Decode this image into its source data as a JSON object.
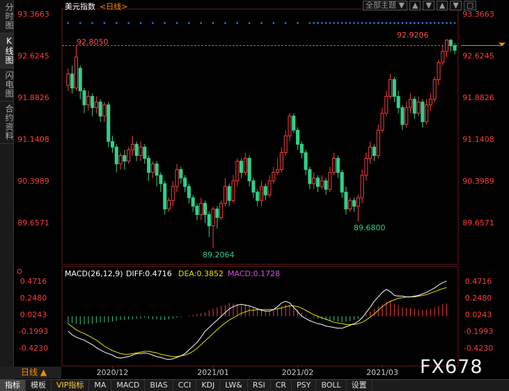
{
  "left_tabs": [
    {
      "label": "分时图",
      "active": false
    },
    {
      "label": "K线图",
      "active": true
    },
    {
      "label": "闪电图",
      "active": false
    },
    {
      "label": "合约资料",
      "active": false
    }
  ],
  "title": {
    "name": "美元指数",
    "period": "<日线>"
  },
  "top_controls": {
    "theme_select": "全部主题",
    "arrow": "▼",
    "buttons": [
      "▲",
      "▼",
      "▲",
      "▼",
      "▢"
    ]
  },
  "colors": {
    "up": "#ff3b3b",
    "down": "#30d08a",
    "dea": "#e8e000",
    "macd": "#d050e0",
    "diff": "#ffffff",
    "grid": "#3a1010",
    "axis_text": "#ff3b3b",
    "dots": "#2f80ed"
  },
  "price_axis": {
    "ticks": [
      "93.3663",
      "92.6245",
      "91.8826",
      "91.1408",
      "90.3989",
      "89.6571"
    ],
    "tick_values": [
      93.3663,
      92.6245,
      91.8826,
      91.1408,
      90.3989,
      89.6571
    ]
  },
  "macd_axis": {
    "ticks": [
      "0.4716",
      "0.2480",
      "0.0243",
      "-0.1993",
      "-0.4230"
    ],
    "tick_values": [
      0.4716,
      0.248,
      0.0243,
      -0.1993,
      -0.423
    ]
  },
  "macd_legend": {
    "name": "MACD(26,12,9)",
    "diff": "DIFF:0.4716",
    "dea": "DEA:0.3852",
    "macd": "MACD:0.1728"
  },
  "annotations": {
    "high_left": "92.8050",
    "high_right": "92.9206",
    "low_main": "89.2064",
    "low_second": "89.6800"
  },
  "x_axis": {
    "labels": [
      "2020/12",
      "2021/01",
      "2021/02",
      "2021/03"
    ],
    "label_index": [
      11,
      36,
      57,
      78
    ]
  },
  "period_label": "日线 ▲",
  "toolbar": [
    {
      "label": "指标",
      "active": true,
      "vip": false
    },
    {
      "label": "模板",
      "active": false,
      "vip": false
    },
    {
      "label": "VIP指标",
      "active": false,
      "vip": true
    },
    {
      "label": "MA",
      "active": false,
      "vip": false
    },
    {
      "label": "MACD",
      "active": false,
      "vip": false
    },
    {
      "label": "BIAS",
      "active": false,
      "vip": false
    },
    {
      "label": "CCI",
      "active": false,
      "vip": false
    },
    {
      "label": "KDJ",
      "active": false,
      "vip": false
    },
    {
      "label": "LW&",
      "active": false,
      "vip": false
    },
    {
      "label": "RSI",
      "active": false,
      "vip": false
    },
    {
      "label": "CR",
      "active": false,
      "vip": false
    },
    {
      "label": "PSY",
      "active": false,
      "vip": false
    },
    {
      "label": "BOLL",
      "active": false,
      "vip": false
    },
    {
      "label": "设置",
      "active": false,
      "vip": false
    }
  ],
  "watermark": "FX678",
  "chart_data": {
    "type": "candlestick",
    "title": "美元指数 <日线>",
    "ylim": [
      89.2,
      93.45
    ],
    "candles": [
      [
        92.1,
        92.3,
        92.0,
        92.4
      ],
      [
        92.3,
        92.05,
        91.95,
        92.45
      ],
      [
        92.05,
        92.6,
        92.0,
        92.81
      ],
      [
        92.4,
        92.0,
        91.85,
        92.45
      ],
      [
        92.0,
        91.75,
        91.6,
        92.05
      ],
      [
        91.75,
        91.9,
        91.65,
        92.0
      ],
      [
        91.9,
        91.7,
        91.55,
        91.95
      ],
      [
        91.7,
        91.8,
        91.6,
        91.9
      ],
      [
        91.8,
        91.55,
        91.45,
        91.85
      ],
      [
        91.55,
        91.75,
        91.45,
        91.8
      ],
      [
        91.75,
        91.1,
        91.0,
        91.8
      ],
      [
        91.1,
        91.0,
        90.9,
        91.2
      ],
      [
        91.0,
        90.7,
        90.55,
        91.05
      ],
      [
        90.7,
        90.85,
        90.6,
        90.9
      ],
      [
        90.85,
        90.75,
        90.6,
        90.95
      ],
      [
        90.75,
        90.95,
        90.7,
        91.0
      ],
      [
        90.95,
        91.05,
        90.85,
        91.2
      ],
      [
        91.05,
        90.85,
        90.75,
        91.1
      ],
      [
        90.85,
        91.0,
        90.75,
        91.1
      ],
      [
        91.0,
        90.8,
        90.7,
        91.05
      ],
      [
        90.8,
        90.55,
        90.4,
        90.85
      ],
      [
        90.55,
        90.7,
        90.45,
        90.75
      ],
      [
        90.7,
        90.5,
        90.3,
        90.75
      ],
      [
        90.5,
        90.35,
        90.2,
        90.55
      ],
      [
        90.35,
        89.9,
        89.8,
        90.4
      ],
      [
        89.9,
        90.05,
        89.85,
        90.1
      ],
      [
        90.05,
        90.3,
        89.95,
        90.4
      ],
      [
        90.3,
        90.6,
        90.2,
        90.7
      ],
      [
        90.6,
        90.45,
        90.35,
        90.65
      ],
      [
        90.45,
        90.3,
        90.2,
        90.5
      ],
      [
        90.3,
        90.1,
        90.0,
        90.35
      ],
      [
        90.1,
        89.95,
        89.85,
        90.15
      ],
      [
        89.95,
        89.8,
        89.7,
        90.0
      ],
      [
        89.8,
        90.0,
        89.7,
        90.1
      ],
      [
        90.0,
        89.8,
        89.65,
        90.05
      ],
      [
        89.8,
        89.6,
        89.4,
        89.85
      ],
      [
        89.6,
        89.9,
        89.21,
        89.95
      ],
      [
        89.9,
        89.75,
        89.55,
        89.95
      ],
      [
        89.75,
        90.0,
        89.7,
        90.05
      ],
      [
        90.0,
        90.3,
        89.95,
        90.45
      ],
      [
        90.3,
        90.05,
        89.95,
        90.35
      ],
      [
        90.05,
        90.4,
        90.0,
        90.5
      ],
      [
        90.4,
        90.75,
        90.3,
        90.8
      ],
      [
        90.75,
        90.55,
        90.45,
        90.8
      ],
      [
        90.55,
        90.8,
        90.5,
        90.9
      ],
      [
        90.8,
        90.4,
        90.3,
        90.85
      ],
      [
        90.4,
        90.2,
        90.1,
        90.45
      ],
      [
        90.2,
        90.05,
        89.95,
        90.25
      ],
      [
        90.05,
        90.3,
        89.95,
        90.4
      ],
      [
        90.3,
        90.15,
        90.05,
        90.35
      ],
      [
        90.15,
        90.4,
        90.1,
        90.5
      ],
      [
        90.4,
        90.55,
        90.35,
        90.65
      ],
      [
        90.55,
        90.6,
        90.5,
        90.8
      ],
      [
        90.6,
        90.9,
        90.55,
        91.0
      ],
      [
        90.9,
        91.2,
        90.85,
        91.3
      ],
      [
        91.2,
        91.55,
        91.1,
        91.6
      ],
      [
        91.55,
        91.3,
        91.25,
        91.6
      ],
      [
        91.3,
        91.05,
        90.95,
        91.35
      ],
      [
        91.05,
        90.9,
        90.8,
        91.1
      ],
      [
        90.9,
        90.6,
        90.5,
        90.95
      ],
      [
        90.6,
        90.35,
        90.25,
        90.65
      ],
      [
        90.35,
        90.45,
        90.25,
        90.55
      ],
      [
        90.45,
        90.3,
        90.2,
        90.5
      ],
      [
        90.3,
        90.4,
        90.25,
        90.5
      ],
      [
        90.4,
        90.25,
        90.15,
        90.45
      ],
      [
        90.25,
        90.55,
        90.2,
        90.65
      ],
      [
        90.55,
        90.8,
        90.5,
        90.9
      ],
      [
        90.8,
        90.55,
        90.45,
        90.85
      ],
      [
        90.55,
        90.2,
        90.1,
        90.6
      ],
      [
        90.2,
        89.9,
        89.8,
        90.3
      ],
      [
        89.9,
        90.05,
        89.85,
        90.1
      ],
      [
        90.05,
        89.95,
        89.85,
        90.1
      ],
      [
        89.95,
        90.1,
        89.68,
        90.15
      ],
      [
        90.1,
        90.5,
        90.0,
        90.6
      ],
      [
        90.5,
        90.8,
        90.4,
        90.9
      ],
      [
        90.8,
        91.0,
        90.7,
        91.1
      ],
      [
        91.0,
        90.85,
        90.75,
        91.05
      ],
      [
        90.85,
        91.3,
        90.8,
        91.4
      ],
      [
        91.3,
        91.6,
        91.25,
        91.7
      ],
      [
        91.6,
        91.9,
        91.55,
        92.0
      ],
      [
        91.9,
        92.2,
        91.85,
        92.3
      ],
      [
        92.2,
        91.9,
        91.8,
        92.25
      ],
      [
        91.9,
        91.7,
        91.6,
        92.0
      ],
      [
        91.7,
        91.4,
        91.3,
        91.75
      ],
      [
        91.4,
        91.7,
        91.35,
        91.8
      ],
      [
        91.7,
        91.85,
        91.6,
        91.95
      ],
      [
        91.85,
        91.6,
        91.5,
        91.9
      ],
      [
        91.6,
        91.8,
        91.55,
        91.9
      ],
      [
        91.8,
        91.45,
        91.35,
        91.85
      ],
      [
        91.45,
        91.75,
        91.4,
        91.85
      ],
      [
        91.75,
        91.85,
        91.65,
        91.95
      ],
      [
        91.85,
        92.2,
        91.8,
        92.25
      ],
      [
        92.2,
        92.5,
        92.1,
        92.55
      ],
      [
        92.5,
        92.7,
        92.45,
        92.8
      ],
      [
        92.7,
        92.9,
        92.6,
        92.92
      ],
      [
        92.9,
        92.8,
        92.7,
        92.92
      ],
      [
        92.8,
        92.72,
        92.65,
        92.85
      ]
    ],
    "macd": {
      "hist": [
        -0.1,
        -0.09,
        -0.1,
        -0.11,
        -0.11,
        -0.1,
        -0.1,
        -0.09,
        -0.08,
        -0.08,
        -0.08,
        -0.07,
        -0.06,
        -0.05,
        -0.05,
        -0.04,
        -0.04,
        -0.03,
        -0.03,
        -0.02,
        -0.03,
        -0.04,
        -0.04,
        -0.05,
        -0.05,
        -0.04,
        -0.03,
        -0.02,
        -0.01,
        0.0,
        0.01,
        0.02,
        0.03,
        0.04,
        0.05,
        0.08,
        0.1,
        0.12,
        0.14,
        0.15,
        0.18,
        0.17,
        0.16,
        0.15,
        0.15,
        0.13,
        0.12,
        0.1,
        0.09,
        0.08,
        0.07,
        0.08,
        0.1,
        0.14,
        0.16,
        0.15,
        0.12,
        0.09,
        0.05,
        0.02,
        0.0,
        -0.02,
        -0.03,
        -0.04,
        -0.05,
        -0.06,
        -0.06,
        -0.07,
        -0.08,
        -0.07,
        -0.06,
        -0.05,
        -0.03,
        0.0,
        0.03,
        0.06,
        0.1,
        0.13,
        0.16,
        0.19,
        0.2,
        0.17,
        0.15,
        0.12,
        0.11,
        0.11,
        0.1,
        0.09,
        0.08,
        0.09,
        0.1,
        0.12,
        0.14,
        0.16,
        0.17
      ],
      "diff": [
        -0.2,
        -0.25,
        -0.28,
        -0.3,
        -0.32,
        -0.35,
        -0.38,
        -0.42,
        -0.45,
        -0.48,
        -0.5,
        -0.52,
        -0.55,
        -0.56,
        -0.55,
        -0.54,
        -0.52,
        -0.5,
        -0.5,
        -0.49,
        -0.5,
        -0.52,
        -0.54,
        -0.55,
        -0.57,
        -0.58,
        -0.57,
        -0.55,
        -0.53,
        -0.5,
        -0.45,
        -0.4,
        -0.35,
        -0.28,
        -0.2,
        -0.15,
        -0.1,
        -0.05,
        0.0,
        0.05,
        0.1,
        0.13,
        0.15,
        0.16,
        0.15,
        0.14,
        0.12,
        0.1,
        0.08,
        0.07,
        0.07,
        0.09,
        0.13,
        0.18,
        0.2,
        0.18,
        0.12,
        0.06,
        0.0,
        -0.03,
        -0.06,
        -0.08,
        -0.1,
        -0.11,
        -0.13,
        -0.14,
        -0.15,
        -0.16,
        -0.16,
        -0.14,
        -0.12,
        -0.1,
        -0.07,
        -0.02,
        0.05,
        0.12,
        0.2,
        0.26,
        0.32,
        0.36,
        0.33,
        0.28,
        0.27,
        0.27,
        0.26,
        0.26,
        0.27,
        0.28,
        0.3,
        0.32,
        0.35,
        0.38,
        0.42,
        0.45,
        0.4716
      ],
      "dea": [
        -0.1,
        -0.14,
        -0.18,
        -0.21,
        -0.23,
        -0.26,
        -0.29,
        -0.32,
        -0.36,
        -0.4,
        -0.43,
        -0.46,
        -0.48,
        -0.5,
        -0.51,
        -0.51,
        -0.5,
        -0.49,
        -0.48,
        -0.47,
        -0.47,
        -0.48,
        -0.49,
        -0.51,
        -0.52,
        -0.53,
        -0.54,
        -0.54,
        -0.53,
        -0.52,
        -0.5,
        -0.47,
        -0.43,
        -0.38,
        -0.33,
        -0.28,
        -0.23,
        -0.18,
        -0.13,
        -0.09,
        -0.05,
        -0.02,
        0.01,
        0.04,
        0.06,
        0.08,
        0.08,
        0.09,
        0.09,
        0.09,
        0.09,
        0.09,
        0.1,
        0.11,
        0.13,
        0.14,
        0.14,
        0.13,
        0.11,
        0.08,
        0.05,
        0.02,
        0.0,
        -0.02,
        -0.04,
        -0.06,
        -0.08,
        -0.09,
        -0.1,
        -0.11,
        -0.11,
        -0.11,
        -0.1,
        -0.08,
        -0.05,
        -0.01,
        0.03,
        0.08,
        0.13,
        0.17,
        0.2,
        0.22,
        0.24,
        0.25,
        0.26,
        0.26,
        0.26,
        0.27,
        0.28,
        0.29,
        0.31,
        0.33,
        0.35,
        0.37,
        0.3852
      ]
    },
    "macd_ylim": [
      -0.5,
      0.55
    ]
  }
}
